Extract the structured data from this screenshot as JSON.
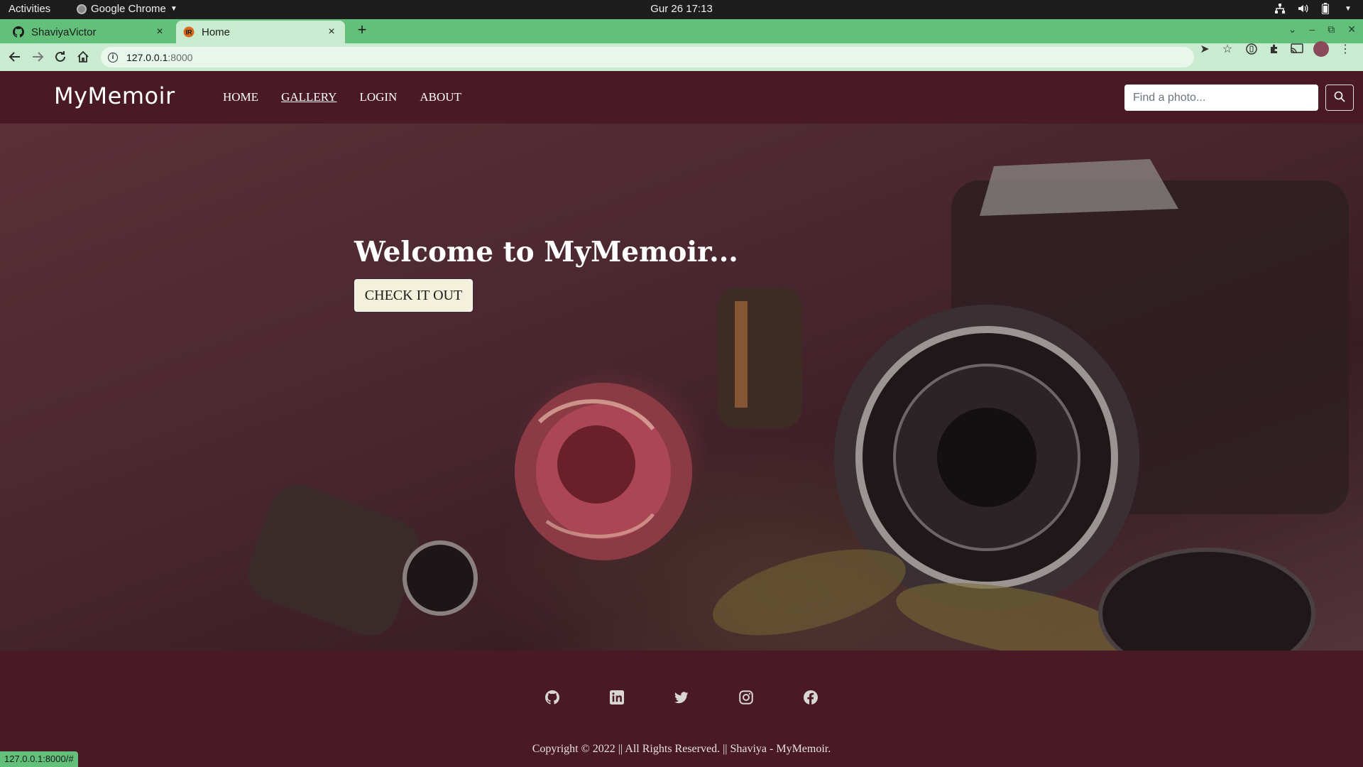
{
  "system_bar": {
    "activities": "Activities",
    "app_name": "Google Chrome",
    "clock": "Gur 26  17:13",
    "tray_icons": [
      "network-icon",
      "volume-icon",
      "battery-icon",
      "system-menu-icon"
    ]
  },
  "browser": {
    "tabs": [
      {
        "title": "ShaviyaVictor",
        "icon": "github-icon",
        "active": false
      },
      {
        "title": "Home",
        "icon": "site-favicon",
        "active": true
      }
    ],
    "url_host": "127.0.0.1",
    "url_rest": ":8000",
    "status_url": "127.0.0.1:8000/#",
    "colors": {
      "frame": "#62c07a",
      "toolbar": "#c9ecd0"
    }
  },
  "site": {
    "brand": "MyMemoir",
    "nav": [
      "HOME",
      "GALLERY",
      "LOGIN",
      "ABOUT"
    ],
    "active_nav": "GALLERY",
    "search_placeholder": "Find a photo...",
    "hero": {
      "title": "Welcome to MyMemoir...",
      "button": "CHECK IT OUT"
    },
    "social_icons": [
      "github-icon",
      "linkedin-icon",
      "twitter-icon",
      "instagram-icon",
      "facebook-icon"
    ],
    "copyright": "Copyright © 2022 || All Rights Reserved. || Shaviya - MyMemoir.",
    "colors": {
      "primary": "#4a1926",
      "button_bg": "#f3f0dc"
    }
  }
}
